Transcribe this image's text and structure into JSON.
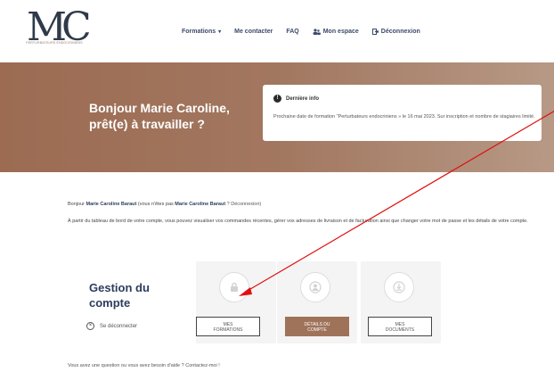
{
  "header": {
    "logo_letters": "MC",
    "logo_tagline": "PERTURBATEURS ENDOCRINIENS",
    "nav": [
      {
        "label": "Formations",
        "icon": "chevron-down-icon"
      },
      {
        "label": "Me contacter"
      },
      {
        "label": "FAQ"
      },
      {
        "label": "Mon espace",
        "icon": "users-icon"
      },
      {
        "label": "Déconnexion",
        "icon": "logout-icon"
      }
    ]
  },
  "hero": {
    "title_line1": "Bonjour Marie Caroline,",
    "title_line2": "prêt(e) à travailler ?",
    "info_title": "Dernière info",
    "info_text": "Prochaine date de formation \"Perturbateurs endocriniens » le 16 mai 2023. Sur inscription et nombre de stagiaires limité."
  },
  "account": {
    "greet_prefix": "Bonjour ",
    "greet_name": "Marie Caroline Baraut",
    "greet_mid": " (vous n'êtes pas ",
    "greet_name2": "Marie Caroline Baraut",
    "greet_link": " ? Déconnexion)",
    "description": "À partir du tableau de bord de votre compte, vous pouvez visualiser vos commandes récentes, gérer vos adresses de livraison et de facturation ainsi que changer votre mot de passe et les détails de votre compte.",
    "section_title_line1": "Gestion du",
    "section_title_line2": "compte",
    "logout_label": "Se déconnecter",
    "cards": [
      {
        "line1": "MES",
        "line2": "FORMATIONS",
        "icon": "lock-icon"
      },
      {
        "line1": "DÉTAILS DU",
        "line2": "COMPTE",
        "icon": "user-icon"
      },
      {
        "line1": "MES",
        "line2": "DOCUMENTS",
        "icon": "download-icon"
      }
    ],
    "help": "Vous avez une question ou vous avez besoin d'aide ? Contactez-moi !"
  },
  "colors": {
    "hero_brown": "#a27760",
    "active_button": "#9f7359",
    "navy": "#2c3e5c",
    "arrow": "#e01010"
  }
}
